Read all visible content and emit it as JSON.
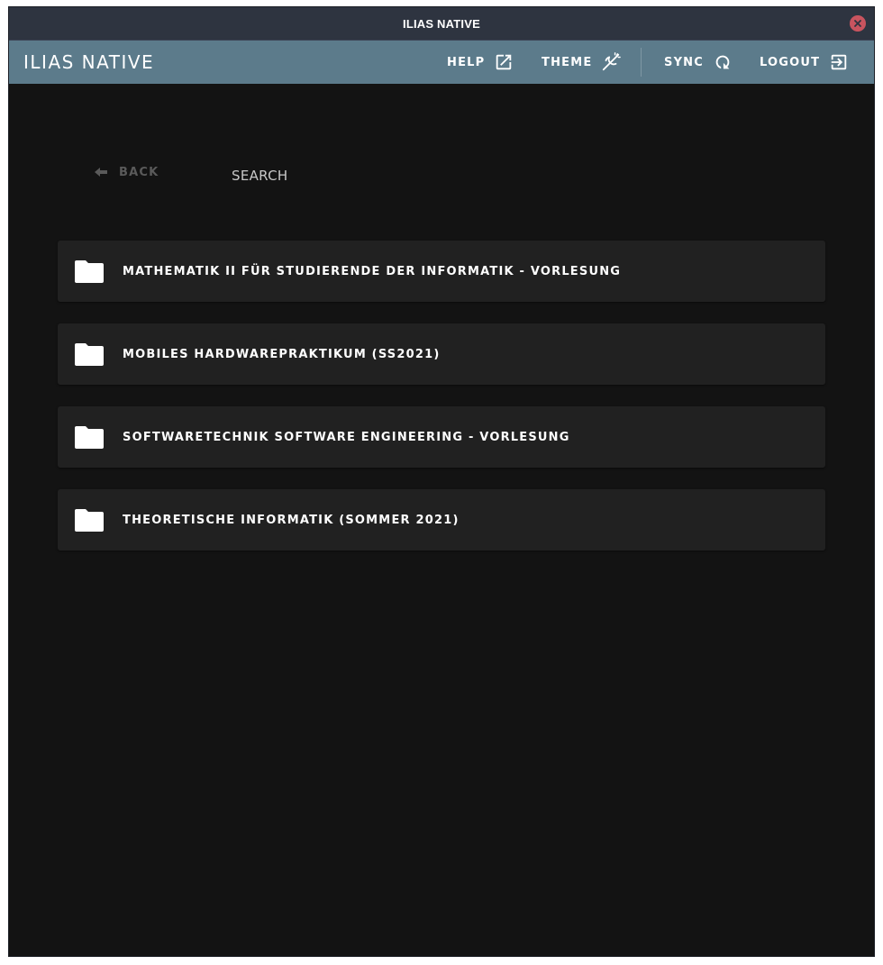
{
  "window": {
    "title": "ILIAS NATIVE",
    "close_icon": "close-icon"
  },
  "appbar": {
    "brand": "ILIAS NATIVE",
    "help_label": "HELP",
    "theme_label": "THEME",
    "sync_label": "SYNC",
    "logout_label": "LOGOUT"
  },
  "toolbar": {
    "back_label": "BACK",
    "search_label": "SEARCH"
  },
  "courses": [
    {
      "name": "MATHEMATIK II FÜR STUDIERENDE DER INFORMATIK - VORLESUNG",
      "icon": "folder-icon"
    },
    {
      "name": "MOBILES HARDWAREPRAKTIKUM (SS2021)",
      "icon": "folder-icon"
    },
    {
      "name": "SOFTWARETECHNIK SOFTWARE ENGINEERING - VORLESUNG",
      "icon": "folder-icon"
    },
    {
      "name": "THEORETISCHE INFORMATIK (SOMMER 2021)",
      "icon": "folder-icon"
    }
  ],
  "colors": {
    "titlebar": "#2e3440",
    "appbar": "#5c7b8b",
    "background": "#131313",
    "card": "#212121",
    "close": "#c9545f"
  }
}
